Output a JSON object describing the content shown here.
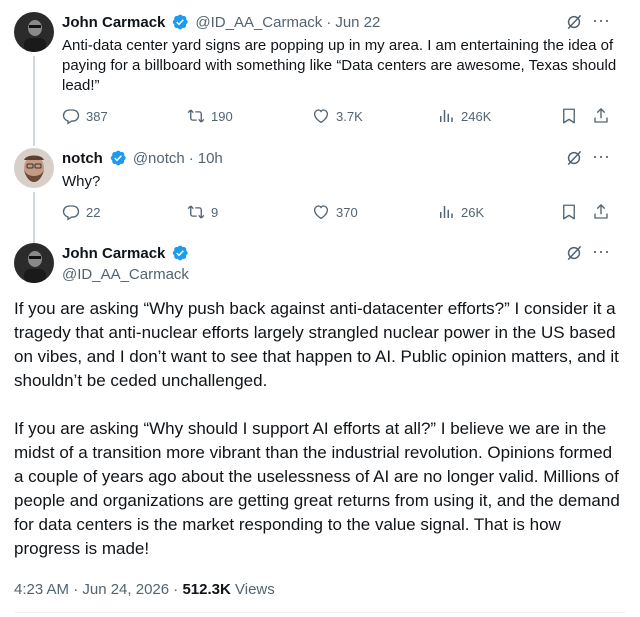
{
  "tweets": [
    {
      "name": "John Carmack",
      "handle": "@ID_AA_Carmack",
      "date": "Jun 22",
      "text": "Anti-data center yard signs are popping up in my area. I am entertaining the idea of paying for a billboard with something like “Data centers are awesome, Texas should lead!”",
      "replies": "387",
      "reposts": "190",
      "likes": "3.7K",
      "views": "246K"
    },
    {
      "name": "notch",
      "handle": "@notch",
      "date": "10h",
      "text": "Why?",
      "replies": "22",
      "reposts": "9",
      "likes": "370",
      "views": "26K"
    }
  ],
  "main": {
    "name": "John Carmack",
    "handle": "@ID_AA_Carmack",
    "paragraphs": [
      "If you are asking “Why push back against anti-datacenter efforts?” I consider it a tragedy that anti-nuclear efforts largely strangled nuclear power in the US based on vibes, and I don’t want to see that happen to AI. Public opinion matters, and it shouldn’t be ceded unchallenged.",
      "If you are asking “Why should I support AI efforts at all?” I believe we are in the midst of a transition more vibrant than the industrial revolution. Opinions formed a couple of years ago about the uselessness of AI are no longer valid. Millions of people and organizations are getting great returns from using it, and the demand for data centers is the market responding to the value signal. That is how progress is made!"
    ],
    "time": "4:23 AM · Jun 24, 2026",
    "dot": "·",
    "views_count": "512.3K",
    "views_label": "Views"
  },
  "ui": {
    "dot": "·",
    "more": "···"
  },
  "colors": {
    "verified": "#1d9bf0",
    "secondary_text": "#536471",
    "thread_line": "#cfd9de"
  },
  "icons": {
    "reply": "reply-icon",
    "repost": "repost-icon",
    "like": "heart-icon",
    "views": "views-bar-icon",
    "bookmark": "bookmark-icon",
    "share": "share-icon",
    "grok": "grok-icon",
    "more": "more-icon",
    "verified": "verified-badge-icon"
  }
}
